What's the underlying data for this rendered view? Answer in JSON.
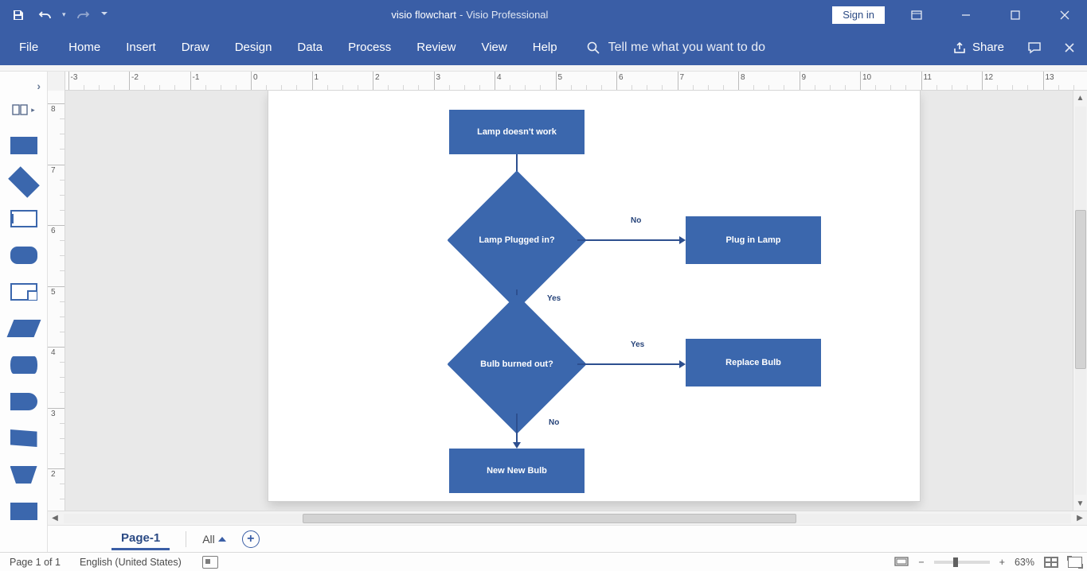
{
  "titlebar": {
    "doc_name": "visio flowchart",
    "separator": "  -  ",
    "app_name": "Visio Professional",
    "signin": "Sign in"
  },
  "ribbon": {
    "tabs": [
      "File",
      "Home",
      "Insert",
      "Draw",
      "Design",
      "Data",
      "Process",
      "Review",
      "View",
      "Help"
    ],
    "tellme": "Tell me what you want to do",
    "share": "Share"
  },
  "hruler": {
    "labels": [
      "-3",
      "-2",
      "-1",
      "0",
      "1",
      "2",
      "3",
      "4",
      "5",
      "6",
      "7",
      "8",
      "9",
      "10",
      "11",
      "12",
      "13"
    ]
  },
  "vruler": {
    "labels": [
      "8",
      "7",
      "6",
      "5",
      "4",
      "3",
      "2"
    ]
  },
  "flowchart": {
    "start": "Lamp doesn't work",
    "decision1": "Lamp Plugged in?",
    "decision1_no": "No",
    "action1": "Plug in Lamp",
    "decision1_yes": "Yes",
    "decision2": "Bulb burned out?",
    "decision2_yes": "Yes",
    "action2": "Replace Bulb",
    "decision2_no": "No",
    "end": "New New Bulb"
  },
  "pagetabs": {
    "page1": "Page-1",
    "all": "All"
  },
  "status": {
    "pageinfo": "Page 1 of 1",
    "language": "English (United States)",
    "zoom_out": "−",
    "zoom_in": "+",
    "zoom_pct": "63%"
  }
}
